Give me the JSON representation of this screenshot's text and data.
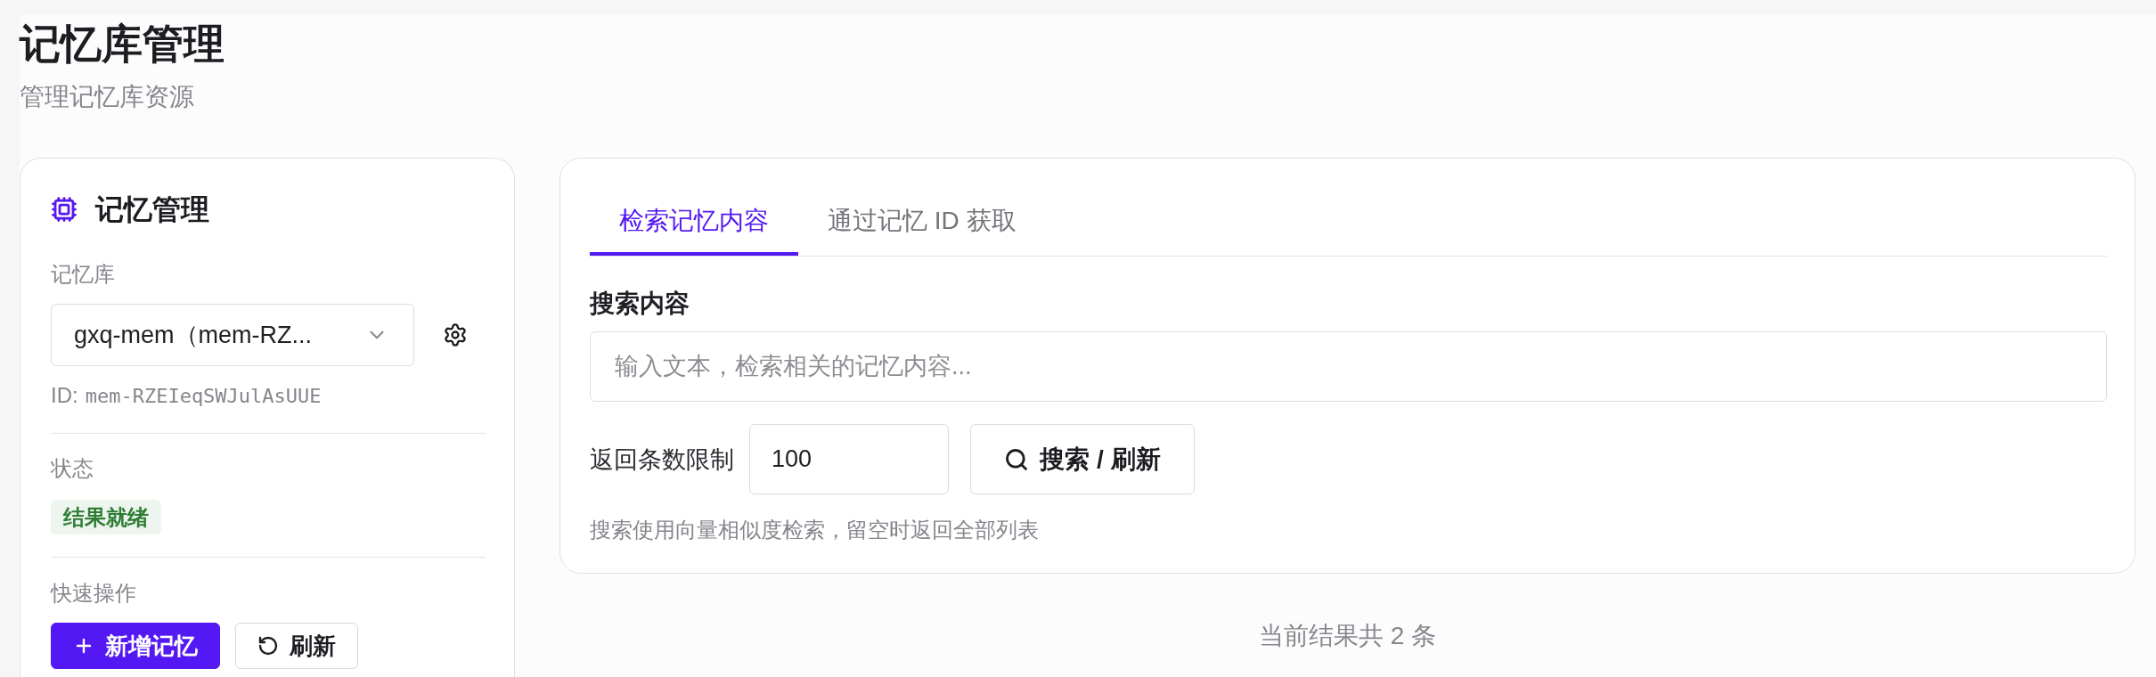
{
  "page": {
    "title": "记忆库管理",
    "subtitle": "管理记忆库资源"
  },
  "memory_panel": {
    "title": "记忆管理",
    "store_label": "记忆库",
    "store_select": {
      "value": "gxq-mem（mem-RZ..."
    },
    "id_label": "ID:",
    "id_value": "mem-RZEIeqSWJulAsUUE",
    "status_label": "状态",
    "status": "结果就绪",
    "actions_label": "快速操作",
    "actions": [
      {
        "label": "新增记忆",
        "kind": "primary"
      },
      {
        "label": "刷新",
        "kind": "secondary"
      }
    ]
  },
  "search_panel": {
    "tabs": [
      {
        "label": "检索记忆内容",
        "selected": true
      },
      {
        "label": "通过记忆 ID 获取",
        "selected": false
      }
    ],
    "query_label": "搜索内容",
    "query_field": {
      "placeholder": "输入文本，检索相关的记忆内容..."
    },
    "limit_label": "返回条数限制",
    "limit_field": {
      "value": "100"
    },
    "search_button": "搜索 / 刷新",
    "hint": "搜索使用向量相似度检索，留空时返回全部列表"
  },
  "result_count": "当前结果共 2 条"
}
